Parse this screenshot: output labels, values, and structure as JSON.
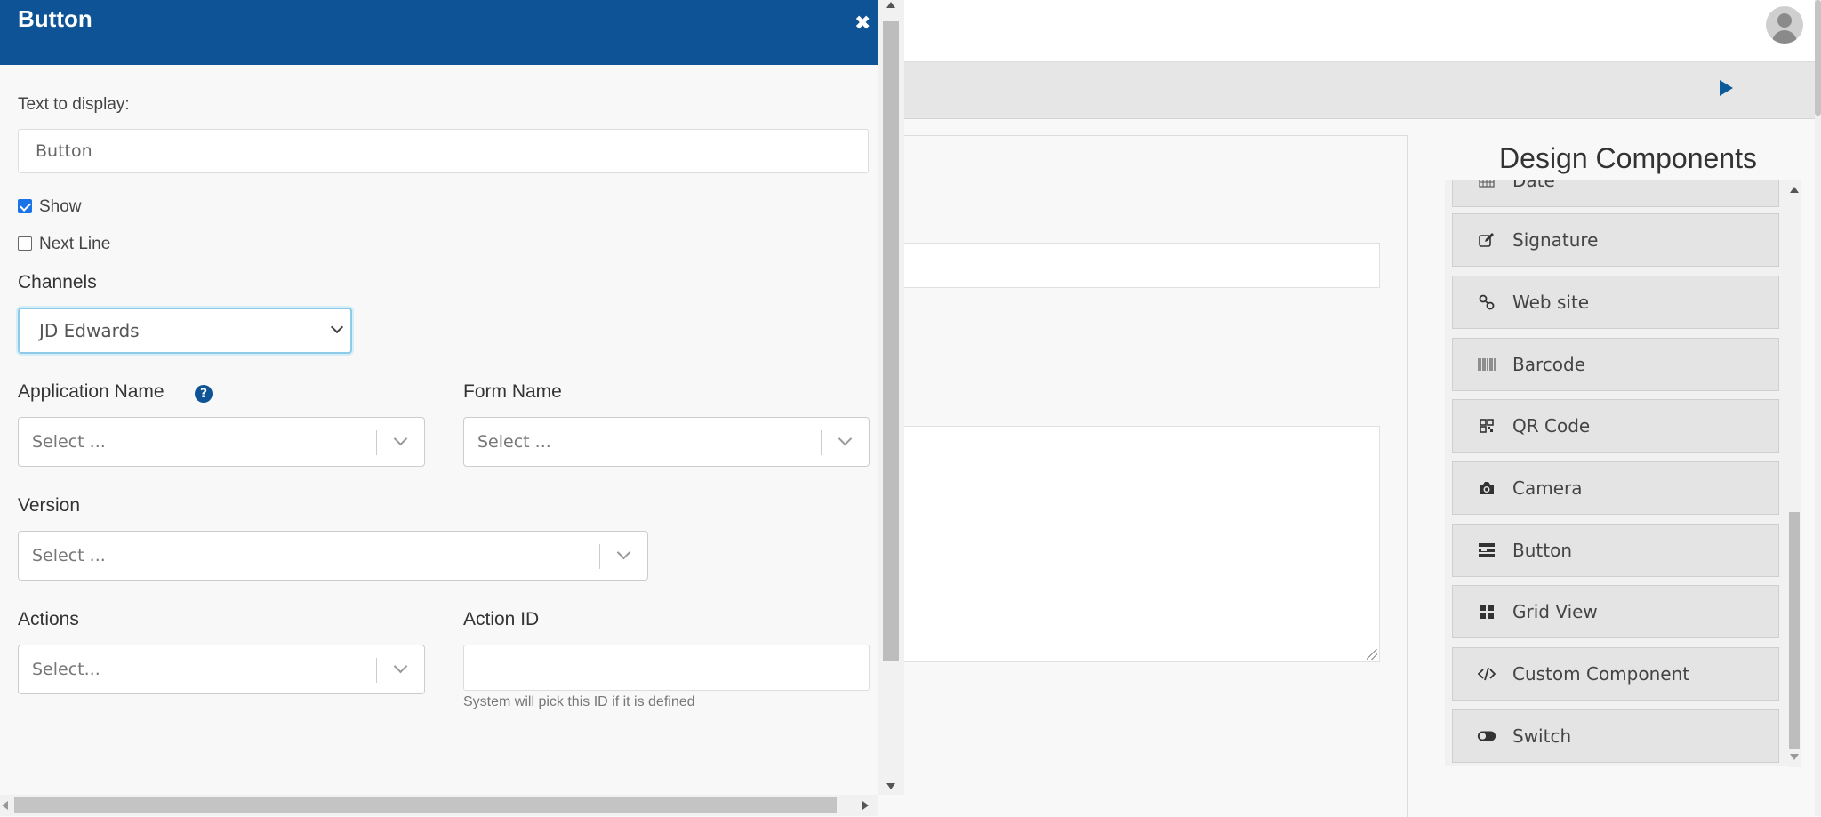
{
  "modal": {
    "title": "Button",
    "close_icon": "close-icon",
    "text_to_display_label": "Text to display:",
    "text_to_display_value": "Button",
    "show_label": "Show",
    "show_checked": true,
    "next_line_label": "Next Line",
    "next_line_checked": false,
    "channels_label": "Channels",
    "channels_value": "JD Edwards",
    "application_name_label": "Application Name",
    "application_name_placeholder": "Select ...",
    "form_name_label": "Form Name",
    "form_name_placeholder": "Select ...",
    "version_label": "Version",
    "version_placeholder": "Select ...",
    "actions_label": "Actions",
    "actions_placeholder": "Select...",
    "action_id_label": "Action ID",
    "action_id_value": "",
    "action_id_hint": "System will pick this ID if it is defined",
    "help_glyph": "?"
  },
  "design_components": {
    "title": "Design Components",
    "items": [
      {
        "label": "Date",
        "icon": "calendar-icon"
      },
      {
        "label": "Signature",
        "icon": "edit-icon"
      },
      {
        "label": "Web site",
        "icon": "link-icon"
      },
      {
        "label": "Barcode",
        "icon": "barcode-icon"
      },
      {
        "label": "QR Code",
        "icon": "qrcode-icon"
      },
      {
        "label": "Camera",
        "icon": "camera-icon"
      },
      {
        "label": "Button",
        "icon": "button-icon"
      },
      {
        "label": "Grid View",
        "icon": "grid-icon"
      },
      {
        "label": "Custom Component",
        "icon": "code-icon"
      },
      {
        "label": "Switch",
        "icon": "toggle-icon"
      }
    ]
  },
  "colors": {
    "header_blue": "#0d5395",
    "accent_blue": "#1a73e8",
    "focus_border": "#8ecbe8"
  }
}
